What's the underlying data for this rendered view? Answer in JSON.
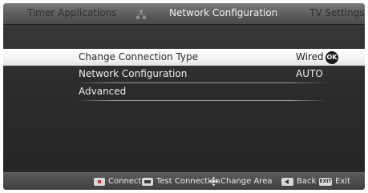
{
  "tabs": {
    "left": "Timer Applications",
    "active": "Network Configuration",
    "right": "TV Settings"
  },
  "menu": {
    "items": [
      {
        "label": "Change Connection Type",
        "value": "Wired",
        "selected": true,
        "badge": "OK"
      },
      {
        "label": "Network Configuration",
        "value": "AUTO",
        "selected": false
      },
      {
        "label": "Advanced",
        "value": "",
        "selected": false
      }
    ]
  },
  "footer": {
    "connect": "Connect",
    "test_connection": "Test Connection",
    "change_area": "Change Area",
    "back": "Back",
    "exit_key": "EXIT",
    "exit": "Exit"
  },
  "colors": {
    "background": "#2c2c2c",
    "tabbar": "#5c5c5c",
    "selected_row": "#f3f3f3",
    "text": "#efefef",
    "red_key": "#c0392b"
  },
  "icons": [
    "network-settings-icon",
    "ok-button-icon",
    "red-key-icon",
    "green-key-icon",
    "dpad-icon",
    "back-key-icon",
    "exit-key-icon"
  ]
}
